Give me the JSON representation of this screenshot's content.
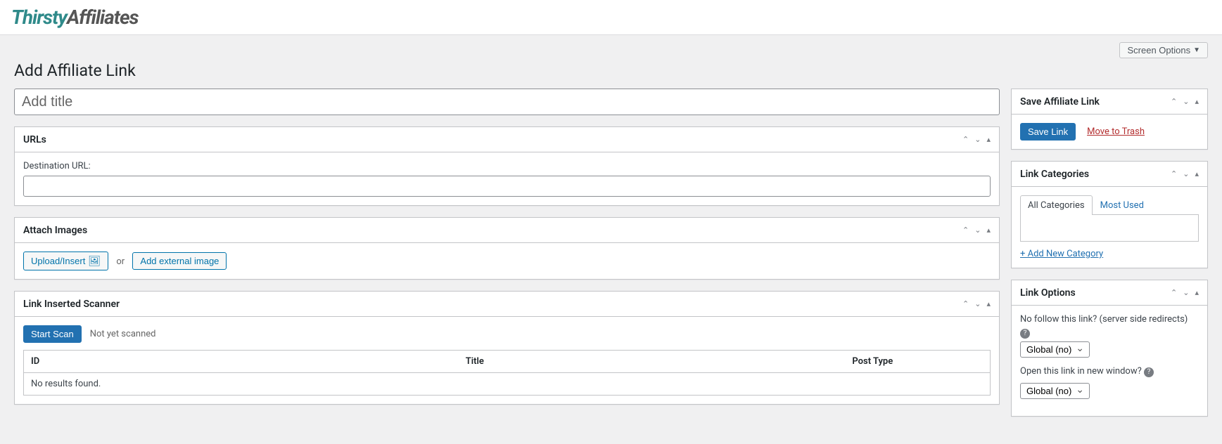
{
  "brand": {
    "part1": "Thirsty",
    "part2": "Affiliates"
  },
  "screen_options_label": "Screen Options",
  "page_title": "Add Affiliate Link",
  "title_placeholder": "Add title",
  "metaboxes": {
    "urls": {
      "title": "URLs",
      "destination_label": "Destination URL:"
    },
    "attach": {
      "title": "Attach Images",
      "upload_label": "Upload/Insert",
      "or_text": "or",
      "external_label": "Add external image"
    },
    "scanner": {
      "title": "Link Inserted Scanner",
      "start_label": "Start Scan",
      "status": "Not yet scanned",
      "columns": {
        "id": "ID",
        "title": "Title",
        "post_type": "Post Type"
      },
      "empty": "No results found."
    }
  },
  "sidebar": {
    "save": {
      "title": "Save Affiliate Link",
      "button": "Save Link",
      "trash": "Move to Trash"
    },
    "categories": {
      "title": "Link Categories",
      "tabs": {
        "all": "All Categories",
        "most": "Most Used"
      },
      "add_new": "+ Add New Category"
    },
    "options": {
      "title": "Link Options",
      "nofollow_label": "No follow this link? (server side redirects)",
      "nofollow_value": "Global (no)",
      "newwindow_label": "Open this link in new window?",
      "newwindow_value": "Global (no)"
    }
  }
}
